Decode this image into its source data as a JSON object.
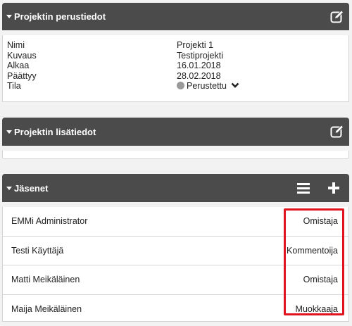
{
  "basic": {
    "title": "Projektin perustiedot",
    "edit_icon": "edit-icon",
    "fields": [
      {
        "label": "Nimi",
        "value": "Projekti 1"
      },
      {
        "label": "Kuvaus",
        "value": "Testiprojekti"
      },
      {
        "label": "Alkaa",
        "value": "16.01.2018"
      },
      {
        "label": "Päättyy",
        "value": "28.02.2018"
      }
    ],
    "status": {
      "label": "Tila",
      "value": "Perustettu",
      "dot_color": "#9a9a9a"
    }
  },
  "additional": {
    "title": "Projektin lisätiedot",
    "edit_icon": "edit-icon"
  },
  "members": {
    "title": "Jäsenet",
    "list_icon": "list-icon",
    "add_icon": "plus-icon",
    "rows": [
      {
        "name": "EMMi Administrator",
        "role": "Omistaja"
      },
      {
        "name": "Testi Käyttäjä",
        "role": "Kommentoija"
      },
      {
        "name": "Matti Meikäläinen",
        "role": "Omistaja"
      },
      {
        "name": "Maija Meikäläinen",
        "role": "Muokkaaja"
      }
    ]
  },
  "colors": {
    "header_bg": "#4b4b4b",
    "highlight": "#e0141e"
  }
}
